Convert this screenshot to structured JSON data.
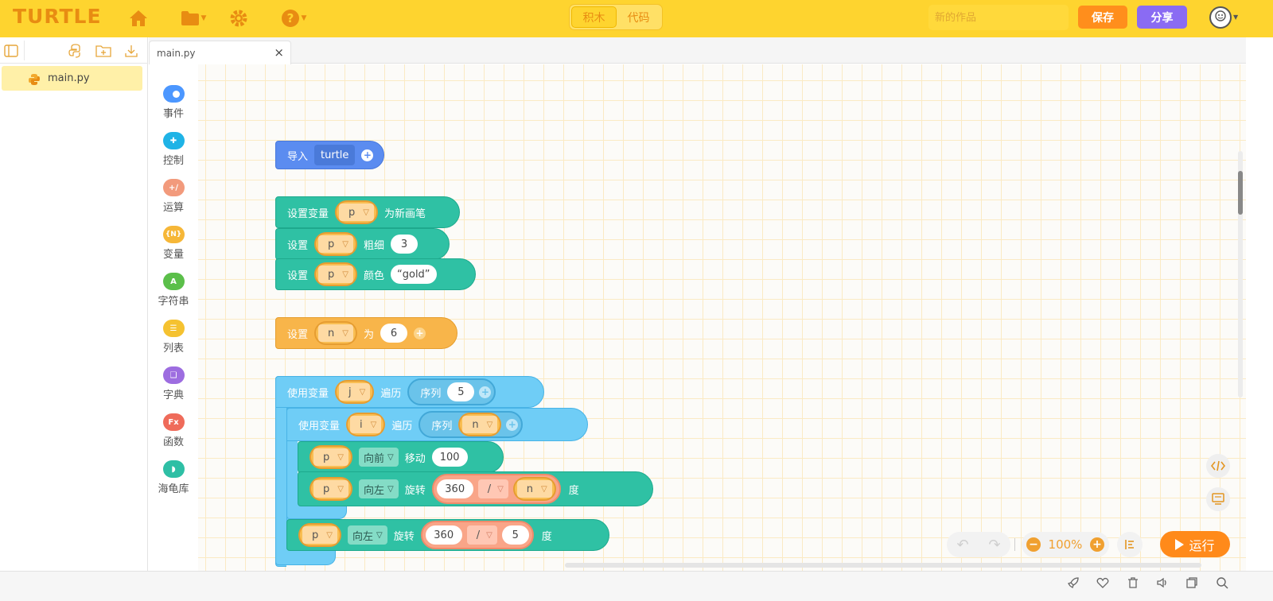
{
  "app": {
    "logo": "TURTLE",
    "mode_tabs": [
      "积木",
      "代码"
    ],
    "title_placeholder": "新的作品",
    "save_label": "保存",
    "share_label": "分享"
  },
  "files": {
    "items": [
      "main.py"
    ]
  },
  "tabs": {
    "open": "main.py",
    "close_glyph": "×"
  },
  "categories": [
    {
      "label": "事件",
      "color": "#4c97ff",
      "icon": "toggle-icon"
    },
    {
      "label": "控制",
      "color": "#1fb3e6",
      "icon": "gamepad-icon"
    },
    {
      "label": "运算",
      "color": "#f29a7c",
      "icon": "math-ops-icon"
    },
    {
      "label": "变量",
      "color": "#f6b738",
      "icon": "variable-icon"
    },
    {
      "label": "字符串",
      "color": "#5bbf4a",
      "icon": "string-icon"
    },
    {
      "label": "列表",
      "color": "#f5c230",
      "icon": "list-icon"
    },
    {
      "label": "字典",
      "color": "#9d6de0",
      "icon": "book-icon"
    },
    {
      "label": "函数",
      "color": "#ef6b5a",
      "icon": "function-icon"
    },
    {
      "label": "海龟库",
      "color": "#2ebfa5",
      "icon": "turtle-icon"
    }
  ],
  "blocks": {
    "import": {
      "label": "导入",
      "module": "turtle"
    },
    "new_pen": {
      "set_var": "设置变量",
      "var": "p",
      "as_new_pen": "为新画笔"
    },
    "pensize": {
      "set": "设置",
      "var": "p",
      "prop": "粗细",
      "value": "3"
    },
    "pencolor": {
      "set": "设置",
      "var": "p",
      "prop": "颜色",
      "value": "“gold”"
    },
    "set_n": {
      "set": "设置",
      "var": "n",
      "to": "为",
      "value": "6"
    },
    "loop_j": {
      "use_var": "使用变量",
      "var": "j",
      "iterate": "遍历",
      "range": "序列",
      "value": "5"
    },
    "loop_i": {
      "use_var": "使用变量",
      "var": "i",
      "iterate": "遍历",
      "range": "序列",
      "value": "n"
    },
    "forward": {
      "var": "p",
      "dir": "向前",
      "action": "移动",
      "value": "100"
    },
    "turn_inner": {
      "var": "p",
      "dir": "向左",
      "action": "旋转",
      "a": "360",
      "op": "/",
      "b": "n",
      "unit": "度"
    },
    "turn_outer": {
      "var": "p",
      "dir": "向左",
      "action": "旋转",
      "a": "360",
      "op": "/",
      "b": "5",
      "unit": "度"
    }
  },
  "zoom": {
    "value": "100%"
  },
  "run_label": "运行"
}
